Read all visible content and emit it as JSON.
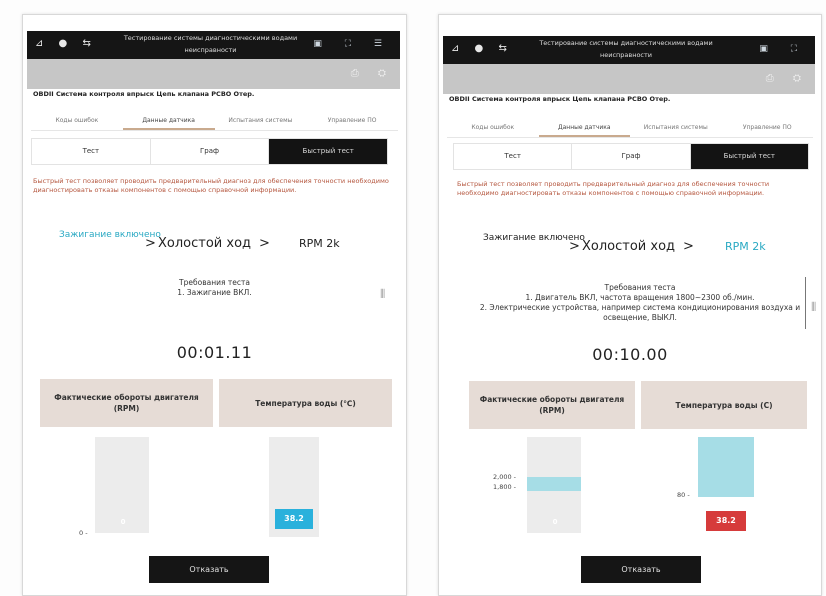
{
  "left": {
    "header": {
      "status_icons": "⊿ ● ⇆",
      "window_title": "Тестирование системы диагностическими водами неисправности",
      "status_right": "▣ ⛶ ☰",
      "gray_icons": "⎙ ⛭",
      "subtitle": "OBDII Система контроля впрыск Цепь клапана PCBO Отер."
    },
    "tabs": [
      "Коды ошибок",
      "Данные датчика",
      "Испытания системы",
      "Управление ПО"
    ],
    "segments": [
      "Тест",
      "Граф",
      "Быстрый тест"
    ],
    "description": "Быстрый тест позволяет проводить предварительный диагноз для обеспечения точности необходимо диагностировать отказы компонентов с помощью справочной информации.",
    "steps": {
      "step1": "Зажигание включено",
      "arrow1": ">",
      "step2": "Холостой ход",
      "arrow2": ">",
      "step3": "RPM 2k"
    },
    "requirements": {
      "title": "Требования теста",
      "items": [
        "1. Зажигание ВКЛ."
      ]
    },
    "timer": "00:01.11",
    "gauges": {
      "rpm_label": "Фактические обороты двигателя (RPM)",
      "temp_label": "Температура воды (℃)",
      "rpm_tick": "0 -",
      "rpm_value": "0",
      "temp_value": "38.2",
      "temp_color": "#2ab1dc"
    },
    "action_button": "Отказать"
  },
  "right": {
    "header": {
      "status_icons": "⊿ ● ⇆",
      "window_title": "Тестирование системы диагностическими водами неисправности",
      "status_right": "▣ ⛶",
      "gray_icons": "⎙ ⛭",
      "subtitle": "OBDII Система контроля впрыск Цепь клапана PCBO Отер."
    },
    "tabs": [
      "Коды ошибок",
      "Данные датчика",
      "Испытания системы",
      "Управление ПО"
    ],
    "segments": [
      "Тест",
      "Граф",
      "Быстрый тест"
    ],
    "description": "Быстрый тест позволяет проводить предварительный диагноз для обеспечения точности необходимо диагностировать отказы компонентов с помощью справочной информации.",
    "steps": {
      "step1": "Зажигание включено",
      "arrow1": ">",
      "step2": "Холостой ход",
      "arrow2": ">",
      "step3": "RPM 2k"
    },
    "requirements": {
      "title": "Требования теста",
      "items": [
        "1. Двигатель ВКЛ, частота вращения 1800~2300 об./мин.",
        "2. Электрические устройства, например система кондиционирования воздуха и освещение, ВЫКЛ."
      ]
    },
    "timer": "00:10.00",
    "gauges": {
      "rpm_label": "Фактические обороты двигателя (RPM)",
      "temp_label": "Температура воды (С)",
      "rpm_tick_high": "2,000 -",
      "rpm_tick_low": "1,800 -",
      "rpm_value": "0",
      "temp_tick": "80 -",
      "temp_value": "38.2",
      "temp_color": "#d63b3b",
      "band_color": "#a6dde6"
    },
    "action_button": "Отказать"
  }
}
